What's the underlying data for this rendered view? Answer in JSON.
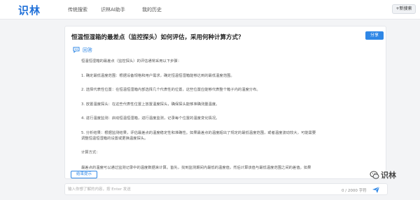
{
  "header": {
    "logo": "识林",
    "nav": [
      "传统搜索",
      "识林AI助手",
      "我的历史"
    ],
    "new_search": "+新搜索"
  },
  "card": {
    "question": "恒温恒湿箱的最差点（监控探头）如何评估，采用何种计算方式？",
    "share": "分享",
    "answer_label": "回答",
    "paragraphs": [
      "恒温恒湿箱的最差点（监控探头）的评估通常采用以下步骤：",
      "1. 确定最低温度范围：根据设备规格和用户需求，确定恒温恒湿箱能够达到的最低温度范围。",
      "2. 选择代表性位置：在恒温恒湿箱内部选择几个代表性的位置，这些位置应能够代表整个箱子内的温度分布。",
      "3. 放置温度探头：在这些代表性位置上放置温度探头，确保探头能够准确测量温度。",
      "4. 进行温度监测：启动恒温恒湿箱，进行温度监测，记录每个位置的温度变化情况。",
      "5. 分析结果：根据监测结果，评估最差点的温度稳定性和准确性。如果最差点的温度超出了规定的最低温度范围，或者温度波动较大，可能需要",
      "调整恒温恒湿箱的设置或更换温度探头。",
      "计算方式：",
      "最差点的温度可以通过监测记录中的温度数据来计算。首先，找到监测期间内最低的温度值，然后计算该值与最低温度范围之间的差值。如果"
    ],
    "stop_button": "结束提示"
  },
  "input": {
    "placeholder": "输入你想了解的内容，按 Enter 发送",
    "value": "",
    "counter": "0 / 2000 字符"
  },
  "watermark": "识林",
  "colors": {
    "accent": "#2f87e6",
    "logo": "#1e6fd8",
    "background": "#f3f4f6"
  },
  "icons": {
    "answer": "chat-bubble-icon",
    "send": "paper-plane-icon",
    "watermark": "wechat-icon"
  }
}
